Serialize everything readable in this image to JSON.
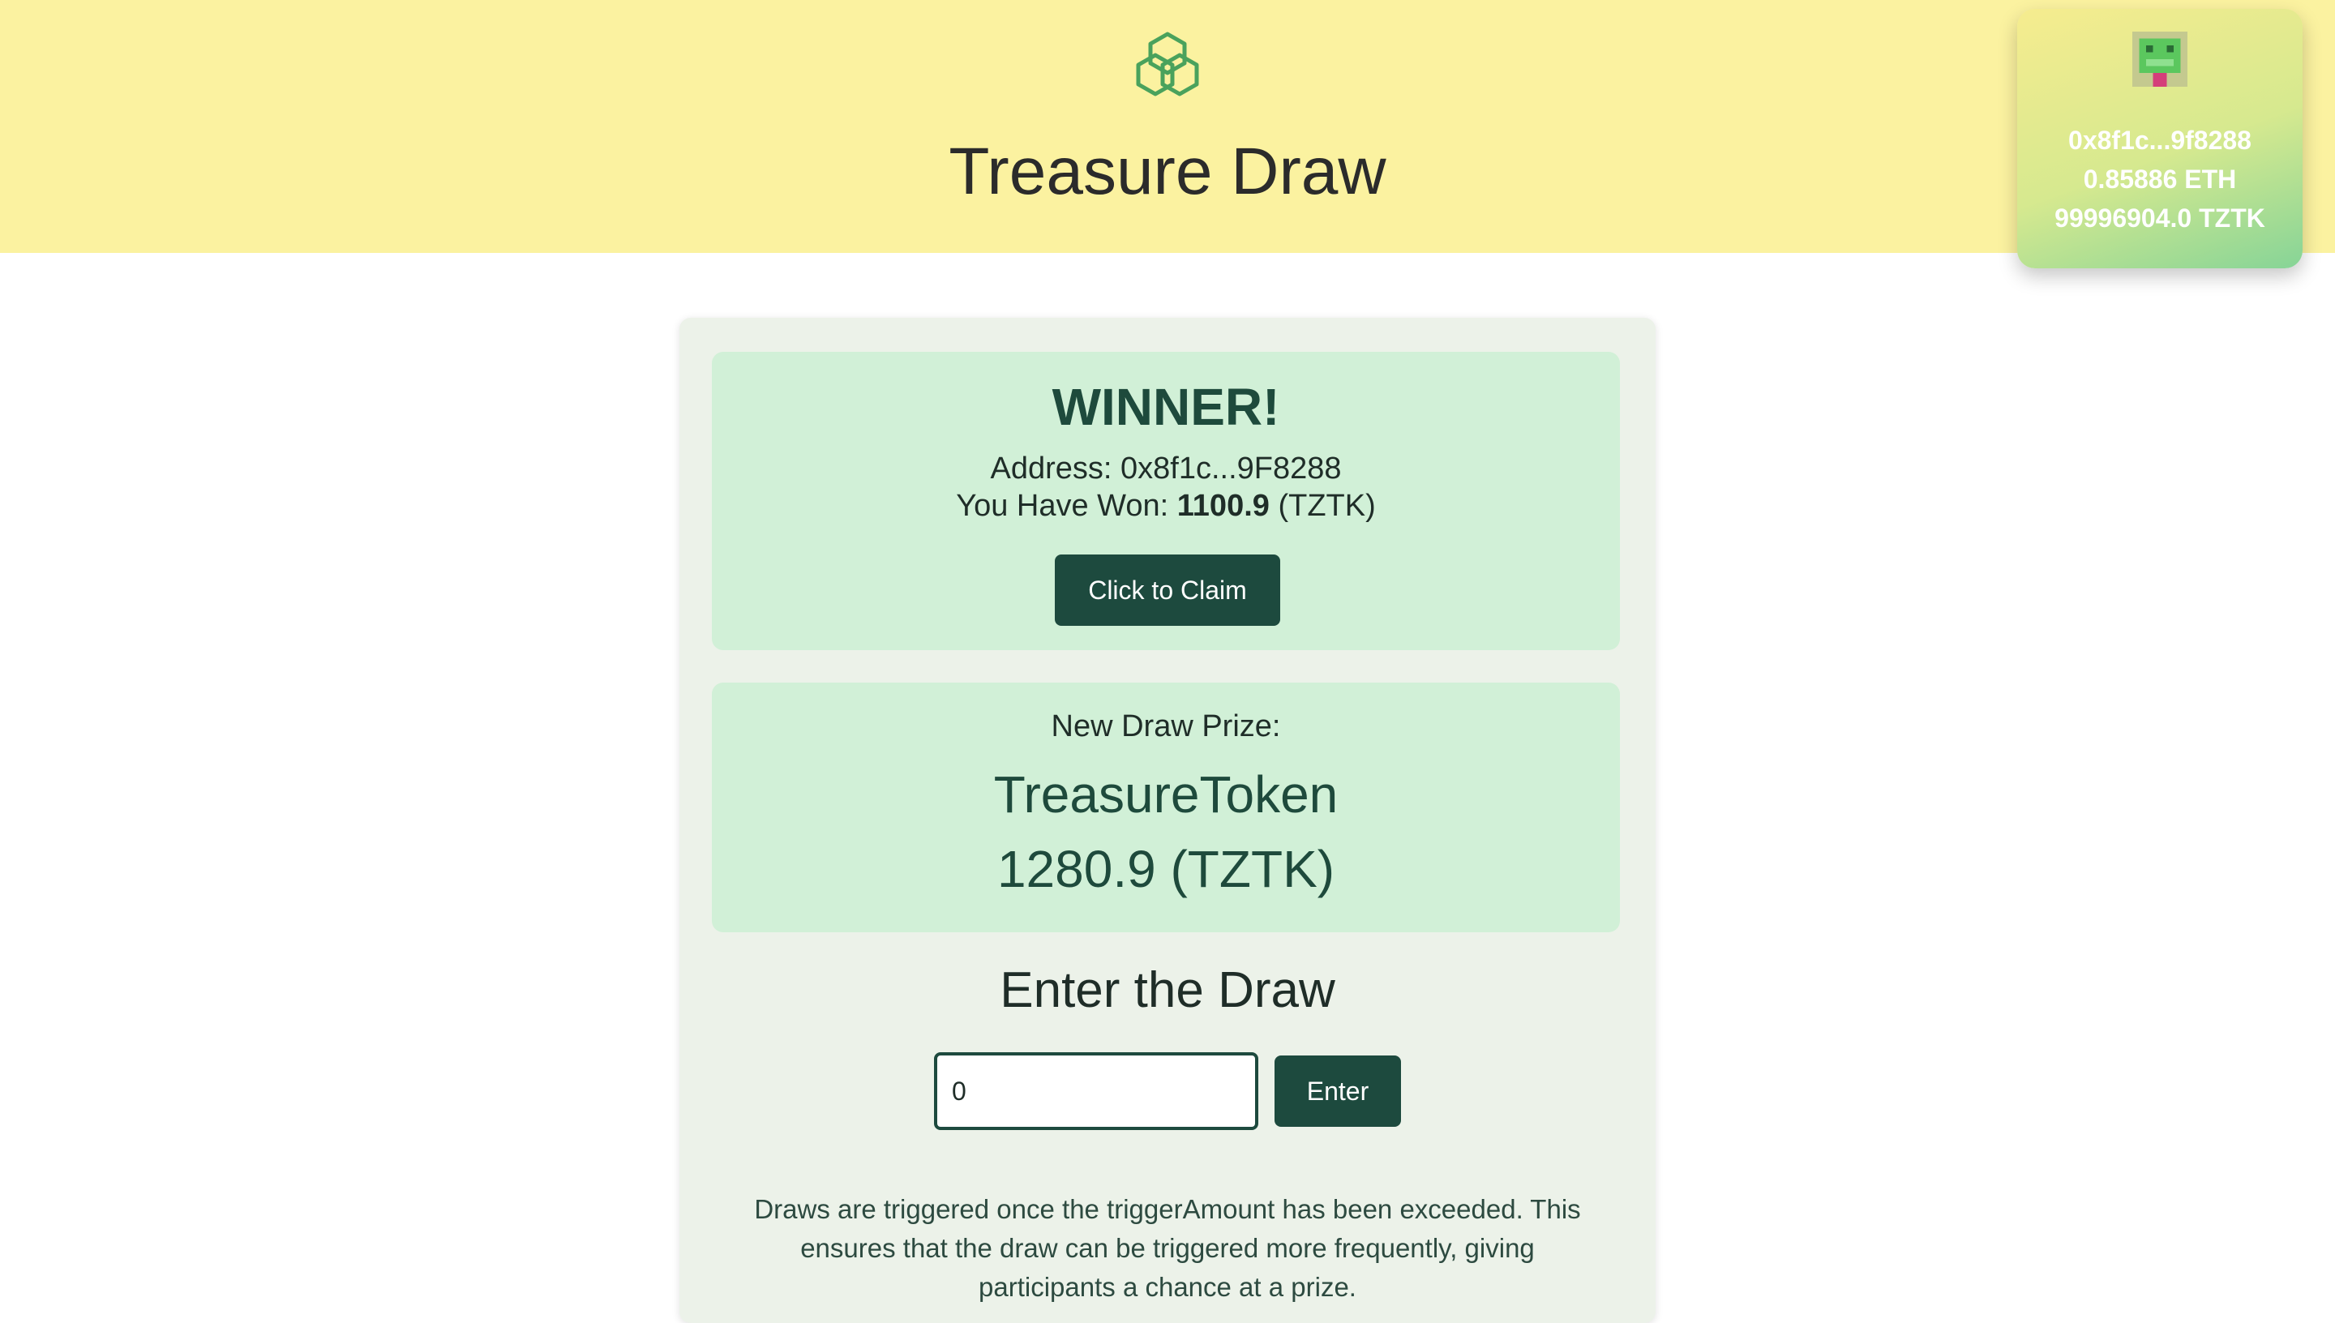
{
  "header": {
    "title": "Treasure Draw",
    "logo_icon": "interlocking-hexagon-logo"
  },
  "wallet": {
    "avatar_icon": "pixel-avatar-icon",
    "address": "0x8f1c...9f8288",
    "eth_balance": "0.85886 ETH",
    "token_balance": "99996904.0 TZTK"
  },
  "winner": {
    "heading": "WINNER!",
    "address_label": "Address:",
    "address": "0x8f1c...9F8288",
    "won_label": "You Have Won:",
    "won_amount": "1100.9",
    "won_unit": "(TZTK)",
    "claim_label": "Click to Claim"
  },
  "prize": {
    "label": "New Draw Prize:",
    "token_name": "TreasureToken",
    "amount": "1280.9 (TZTK)"
  },
  "enter": {
    "heading": "Enter the Draw",
    "input_value": "0",
    "button_label": "Enter"
  },
  "info": {
    "text": "Draws are triggered once the triggerAmount has been exceeded. This ensures that the draw can be triggered more frequently, giving participants a chance at a prize."
  },
  "colors": {
    "header_bg": "#fbf2a0",
    "card_bg": "#ecf2e9",
    "panel_bg": "#d1f0d7",
    "button_bg": "#1d4a3e",
    "accent_text": "#1e4a3c"
  }
}
